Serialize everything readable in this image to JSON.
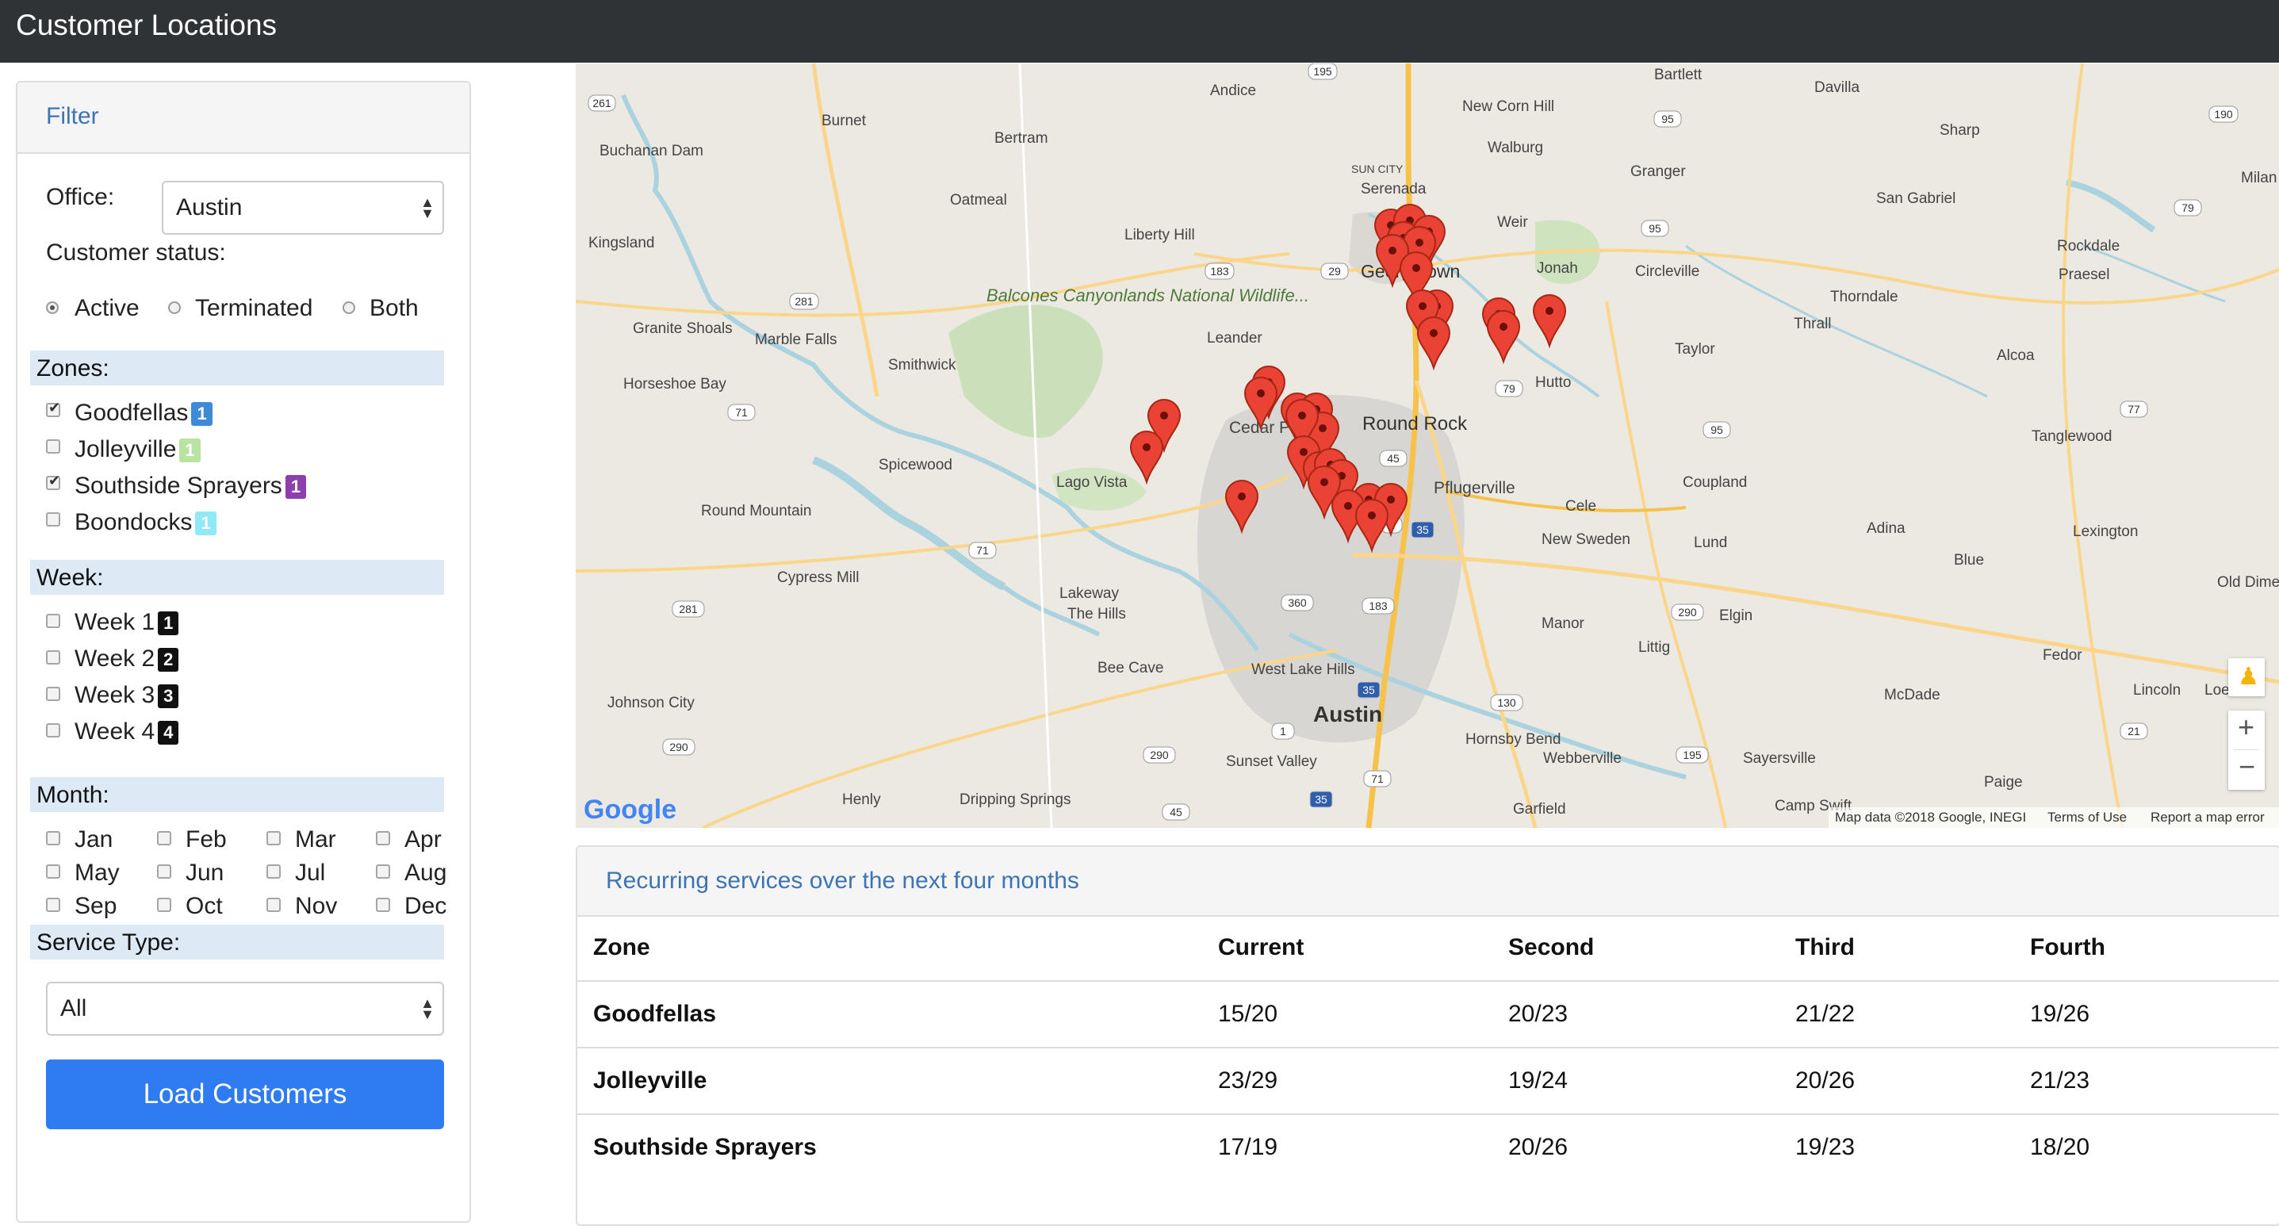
{
  "app": {
    "title": "Customer Locations"
  },
  "filter": {
    "heading": "Filter",
    "office_label": "Office:",
    "office_value": "Austin",
    "status_label": "Customer status:",
    "status_options": [
      "Active",
      "Terminated",
      "Both"
    ],
    "status_selected": "Active",
    "zones_label": "Zones:",
    "zones": [
      {
        "name": "Goodfellas",
        "badge": "1",
        "checked": true,
        "color": "#3f8ad8"
      },
      {
        "name": "Jolleyville",
        "badge": "1",
        "checked": false,
        "color": "#b8e3a0"
      },
      {
        "name": "Southside Sprayers",
        "badge": "1",
        "checked": true,
        "color": "#8d3fb0"
      },
      {
        "name": "Boondocks",
        "badge": "1",
        "checked": false,
        "color": "#8fe9f7"
      }
    ],
    "week_label": "Week:",
    "weeks": [
      {
        "name": "Week 1",
        "badge": "1"
      },
      {
        "name": "Week 2",
        "badge": "2"
      },
      {
        "name": "Week 3",
        "badge": "3"
      },
      {
        "name": "Week 4",
        "badge": "4"
      }
    ],
    "month_label": "Month:",
    "months": [
      "Jan",
      "Feb",
      "Mar",
      "Apr",
      "May",
      "Jun",
      "Jul",
      "Aug",
      "Sep",
      "Oct",
      "Nov",
      "Dec"
    ],
    "service_type_label": "Service Type:",
    "service_type_value": "All",
    "load_button": "Load Customers"
  },
  "map": {
    "labels": {
      "andice": "Andice",
      "bartlett": "Bartlett",
      "davilla": "Davilla",
      "new_corn_hill": "New Corn Hill",
      "walburg": "Walburg",
      "sharp": "Sharp",
      "buchanan_dam": "Buchanan Dam",
      "burnet": "Burnet",
      "bertram": "Bertram",
      "sun_city": "SUN CITY",
      "serenada": "Serenada",
      "granger": "Granger",
      "milan": "Milan",
      "san_gabriel": "San Gabriel",
      "oatmeal": "Oatmeal",
      "weir": "Weir",
      "liberty_hill": "Liberty Hill",
      "kingsland": "Kingsland",
      "georgetown": "Georgetown",
      "jonah": "Jonah",
      "circleville": "Circleville",
      "rockdale": "Rockdale",
      "praesel": "Praesel",
      "thorndale": "Thorndale",
      "balcones": "Balcones Canyonlands National Wildlife...",
      "granite_shoals": "Granite Shoals",
      "marble_falls": "Marble Falls",
      "leander": "Leander",
      "thrall": "Thrall",
      "taylor": "Taylor",
      "alcoa": "Alcoa",
      "horseshoe_bay": "Horseshoe Bay",
      "smithwick": "Smithwick",
      "hutto": "Hutto",
      "cedar_park": "Cedar Park",
      "round_rock": "Round Rock",
      "tanglewood": "Tanglewood",
      "spicewood": "Spicewood",
      "lago_vista": "Lago Vista",
      "coupland": "Coupland",
      "pflugerville": "Pflugerville",
      "round_mountain": "Round Mountain",
      "cele": "Cele",
      "new_sweden": "New Sweden",
      "lund": "Lund",
      "adina": "Adina",
      "lexington": "Lexington",
      "blue": "Blue",
      "cypress_mill": "Cypress Mill",
      "lakeway": "Lakeway",
      "the_hills": "The Hills",
      "old_dime": "Old Dime",
      "manor": "Manor",
      "littig": "Littig",
      "elgin": "Elgin",
      "fedor": "Fedor",
      "bee_cave": "Bee Cave",
      "west_lake_hills": "West Lake Hills",
      "austin": "Austin",
      "johnson_city": "Johnson City",
      "mcdade": "McDade",
      "lincoln": "Lincoln",
      "loeb": "Loeb",
      "hornsby_bend": "Hornsby Bend",
      "webberville": "Webberville",
      "sayersville": "Sayersville",
      "sunset_valley": "Sunset Valley",
      "paige": "Paige",
      "henly": "Henly",
      "dripping_springs": "Dripping Springs",
      "garfield": "Garfield",
      "camp_swift": "Camp Swift"
    },
    "shields": [
      "195",
      "261",
      "95",
      "190",
      "281",
      "183",
      "29",
      "95",
      "79",
      "71",
      "79",
      "95",
      "77",
      "45",
      "1",
      "35",
      "71",
      "360",
      "183",
      "290",
      "281",
      "130",
      "290",
      "35",
      "1",
      "290",
      "21",
      "71",
      "45",
      "35",
      "195"
    ],
    "google_logo": "Google",
    "attribution": "Map data ©2018 Google, INEGI",
    "terms": "Terms of Use",
    "report": "Report a map error",
    "zoom_in": "+",
    "zoom_out": "−"
  },
  "table": {
    "heading": "Recurring services over the next four months",
    "columns": [
      "Zone",
      "Current",
      "Second",
      "Third",
      "Fourth"
    ],
    "rows": [
      {
        "zone": "Goodfellas",
        "current": "15/20",
        "second": "20/23",
        "third": "21/22",
        "fourth": "19/26"
      },
      {
        "zone": "Jolleyville",
        "current": "23/29",
        "second": "19/24",
        "third": "20/26",
        "fourth": "21/23"
      },
      {
        "zone": "Southside Sprayers",
        "current": "17/19",
        "second": "20/26",
        "third": "19/23",
        "fourth": "18/20"
      }
    ]
  }
}
